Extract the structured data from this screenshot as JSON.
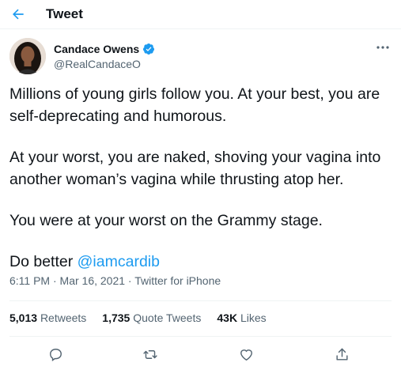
{
  "header": {
    "title": "Tweet",
    "back_icon": "arrow-left-icon"
  },
  "author": {
    "display_name": "Candace Owens",
    "handle": "@RealCandaceO",
    "verified_icon": "verified-badge-icon",
    "verified_color": "#1d9bf0"
  },
  "tweet": {
    "paragraphs": [
      "Millions of young girls follow you. At your best, you are self-deprecating and humorous.",
      "At your worst, you are naked, shoving your vagina into another woman’s vagina while thrusting atop her.",
      "You were at your worst on the Grammy stage."
    ],
    "last_line_prefix": "Do better ",
    "mention": "@iamcardib",
    "mention_color": "#1d9bf0"
  },
  "meta": {
    "text": "6:11 PM · Mar 16, 2021 · Twitter for iPhone"
  },
  "stats": {
    "retweets_count": "5,013",
    "retweets_label": "Retweets",
    "quotes_count": "1,735",
    "quotes_label": "Quote Tweets",
    "likes_count": "43K",
    "likes_label": "Likes"
  },
  "actions": [
    "reply-icon",
    "retweet-icon",
    "like-icon",
    "share-icon"
  ]
}
